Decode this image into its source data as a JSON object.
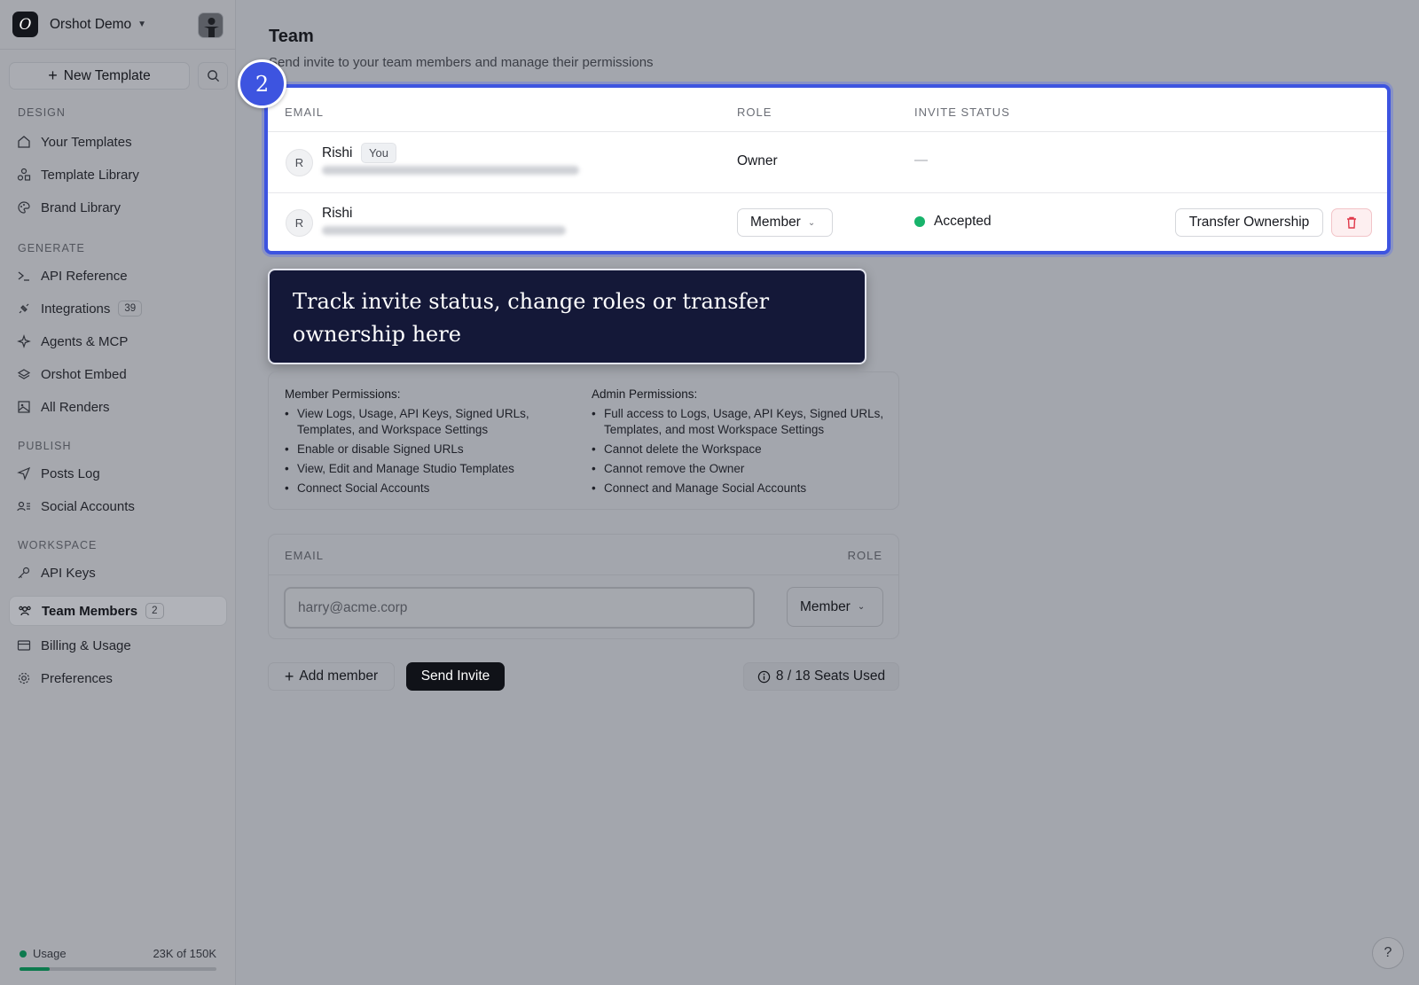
{
  "workspace": {
    "name": "Orshot Demo",
    "logo_letter": "O"
  },
  "sidebar": {
    "new_template_label": "New Template",
    "sections": {
      "design": "DESIGN",
      "generate": "GENERATE",
      "publish": "PUBLISH",
      "workspace": "WORKSPACE"
    },
    "items": [
      {
        "label": "Your Templates",
        "icon": "home-icon"
      },
      {
        "label": "Template Library",
        "icon": "shapes-icon"
      },
      {
        "label": "Brand Library",
        "icon": "palette-icon"
      },
      {
        "label": "API Reference",
        "icon": "terminal-icon"
      },
      {
        "label": "Integrations",
        "icon": "plug-icon",
        "badge": "39"
      },
      {
        "label": "Agents & MCP",
        "icon": "sparkle-icon"
      },
      {
        "label": "Orshot Embed",
        "icon": "layers-icon"
      },
      {
        "label": "All Renders",
        "icon": "image-icon"
      },
      {
        "label": "Posts Log",
        "icon": "send-icon"
      },
      {
        "label": "Social Accounts",
        "icon": "user-list-icon"
      },
      {
        "label": "API Keys",
        "icon": "key-icon"
      },
      {
        "label": "Team Members",
        "icon": "users-icon",
        "badge": "2",
        "active": true
      },
      {
        "label": "Billing & Usage",
        "icon": "card-icon"
      },
      {
        "label": "Preferences",
        "icon": "gear-icon"
      }
    ],
    "usage": {
      "label": "Usage",
      "value": "23K of 150K",
      "fraction": 0.153
    }
  },
  "page": {
    "title": "Team",
    "subtitle": "Send invite to your team members and manage their permissions"
  },
  "team_table": {
    "headers": {
      "email": "EMAIL",
      "role": "ROLE",
      "status": "INVITE STATUS"
    },
    "rows": [
      {
        "initial": "R",
        "name": "Rishi",
        "you_badge": "You",
        "role": "Owner",
        "status": "—"
      },
      {
        "initial": "R",
        "name": "Rishi",
        "role": "Member",
        "status": "Accepted",
        "transfer_label": "Transfer Ownership"
      }
    ]
  },
  "tour": {
    "step": "2",
    "text": "Track invite status, change roles or transfer ownership here"
  },
  "permissions": {
    "member": {
      "title": "Member Permissions:",
      "items": [
        "View Logs, Usage, API Keys, Signed URLs, Templates, and Workspace Settings",
        "Enable or disable Signed URLs",
        "View, Edit and Manage Studio Templates",
        "Connect Social Accounts"
      ]
    },
    "admin": {
      "title": "Admin Permissions:",
      "items": [
        "Full access to Logs, Usage, API Keys, Signed URLs, Templates, and most Workspace Settings",
        "Cannot delete the Workspace",
        "Cannot remove the Owner",
        "Connect and Manage Social Accounts"
      ]
    }
  },
  "invite": {
    "email_header": "EMAIL",
    "role_header": "ROLE",
    "email_placeholder": "harry@acme.corp",
    "role_value": "Member",
    "add_member_label": "Add member",
    "send_label": "Send Invite",
    "seats_label": "8 / 18 Seats Used"
  },
  "help_label": "?",
  "colors": {
    "accent": "#3d54e0",
    "success": "#18b36b",
    "tooltip_bg": "#141838"
  }
}
